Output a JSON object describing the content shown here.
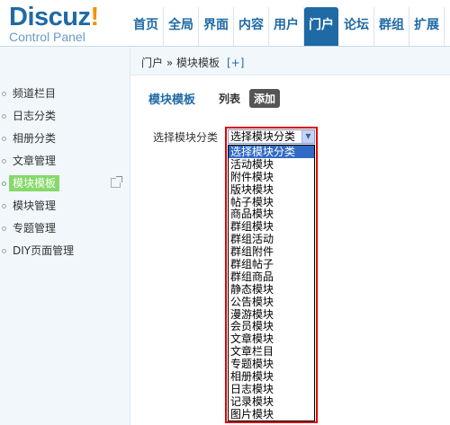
{
  "header": {
    "logo_text": "Discuz",
    "logo_bang": "!",
    "logo_sub": "Control Panel",
    "nav": [
      "首页",
      "全局",
      "界面",
      "内容",
      "用户",
      "门户",
      "论坛",
      "群组",
      "扩展"
    ],
    "active_nav": "门户"
  },
  "breadcrumb": {
    "text": "门户 » 模块模板",
    "add": "[+]"
  },
  "sidebar": {
    "items": [
      {
        "label": "频道栏目"
      },
      {
        "label": "日志分类"
      },
      {
        "label": "相册分类"
      },
      {
        "label": "文章管理"
      },
      {
        "label": "模块模板"
      },
      {
        "label": "模块管理"
      },
      {
        "label": "专题管理"
      },
      {
        "label": "DIY页面管理"
      }
    ],
    "active": "模块模板"
  },
  "main": {
    "title": "模块模板",
    "tab_list": "列表",
    "tab_add": "添加",
    "field_label": "选择模块分类",
    "select_value": "选择模块分类",
    "options": [
      "选择模块分类",
      "活动模块",
      "附件模块",
      "版块模块",
      "帖子模块",
      "商品模块",
      "群组模块",
      "群组活动",
      "群组附件",
      "群组帖子",
      "群组商品",
      "静态模块",
      "公告模块",
      "漫游模块",
      "会员模块",
      "文章模块",
      "文章栏目",
      "专题模块",
      "相册模块",
      "日志模块",
      "记录模块",
      "图片模块"
    ],
    "selected_option": "选择模块分类"
  },
  "colors": {
    "brand": "#1f6aa5",
    "accent": "#f39200",
    "highlight": "#86d96a",
    "frame": "#e00000",
    "selection": "#316ac5"
  }
}
